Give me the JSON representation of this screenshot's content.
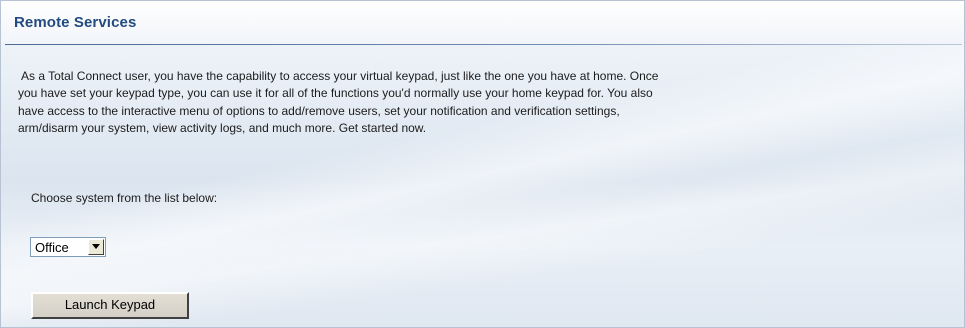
{
  "panel": {
    "title": "Remote Services"
  },
  "intro": {
    "text": "As a Total Connect user, you have the capability to access your virtual keypad, just like the one you have at home. Once you have set your keypad type, you can use it for all of the functions you'd normally use your home keypad for. You also have access to the interactive menu of options to add/remove users, set your notification and verification settings, arm/disarm your system, view activity logs, and much more. Get started now."
  },
  "system_select": {
    "label": "Choose system from the list below:",
    "selected": "Office"
  },
  "launch_button": {
    "label": "Launch Keypad"
  }
}
